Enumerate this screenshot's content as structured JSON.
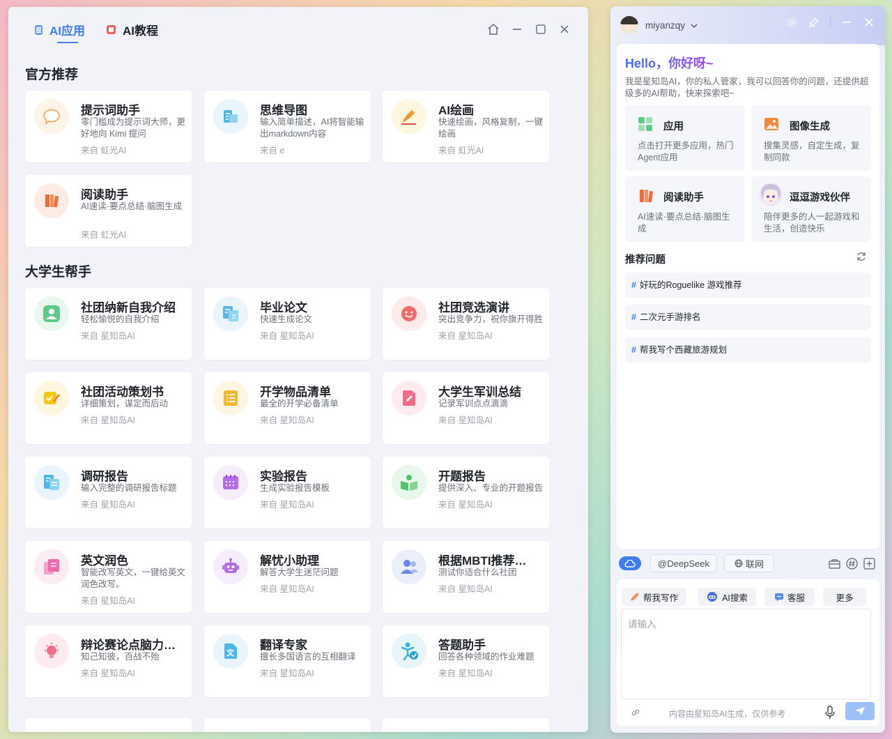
{
  "tabs": [
    {
      "label": "AI应用",
      "active": true
    },
    {
      "label": "AI教程",
      "active": false
    }
  ],
  "sections": [
    {
      "title": "官方推荐",
      "cards": [
        {
          "title": "提示词助手",
          "desc": "零门槛成为提示词大师，更好地向 Kimi 提问",
          "source": "来自 虹光AI",
          "icon": "chat-bubble-icon",
          "color": "#f7a24a"
        },
        {
          "title": "思维导图",
          "desc": "输入简单描述，AI将智能输出markdown内容",
          "source": "来自 e",
          "icon": "mindmap-icon",
          "color": "#4fb7e8"
        },
        {
          "title": "AI绘画",
          "desc": "快速绘画，风格复制，一键绘画",
          "source": "来自 虹光AI",
          "icon": "paint-icon",
          "color": "#f5c518"
        },
        {
          "title": "阅读助手",
          "desc": "AI速读·要点总结·脑图生成",
          "source": "来自 虹光AI",
          "icon": "book-icon",
          "color": "#f26b3a"
        }
      ]
    },
    {
      "title": "大学生帮手",
      "cards": [
        {
          "title": "社团纳新自我介绍",
          "desc": "轻松愉悦的自我介绍",
          "source": "来自 星知岛AI",
          "icon": "person-icon",
          "color": "#5dc98a"
        },
        {
          "title": "毕业论文",
          "desc": "快速生成论文",
          "source": "来自 星知岛AI",
          "icon": "thesis-icon",
          "color": "#5cb5e4"
        },
        {
          "title": "社团竞选演讲",
          "desc": "突出竞争力，祝你旗开得胜",
          "source": "来自 星知岛AI",
          "icon": "smile-icon",
          "color": "#f26b6b"
        },
        {
          "title": "社团活动策划书",
          "desc": "详细策划，谋定而后动",
          "source": "来自 星知岛AI",
          "icon": "plan-icon",
          "color": "#f5c518"
        },
        {
          "title": "开学物品清单",
          "desc": "最全的开学必备清单",
          "source": "来自 星知岛AI",
          "icon": "list-icon",
          "color": "#f5b82e"
        },
        {
          "title": "大学生军训总结",
          "desc": "记录军训点点滴滴",
          "source": "来自 星知岛AI",
          "icon": "edit-icon",
          "color": "#f56c8b"
        },
        {
          "title": "调研报告",
          "desc": "输入完整的调研报告标题",
          "source": "来自 星知岛AI",
          "icon": "report-icon",
          "color": "#4fb7e8"
        },
        {
          "title": "实验报告",
          "desc": "生成实验报告模板",
          "source": "来自 星知岛AI",
          "icon": "calendar-icon",
          "color": "#b46ee8"
        },
        {
          "title": "开题报告",
          "desc": "提供深入、专业的开题报告",
          "source": "来自 星知岛AI",
          "icon": "open-book-icon",
          "color": "#4fc46b"
        },
        {
          "title": "英文润色",
          "desc": "智能改写英文，一键给英文润色改写。",
          "source": "来自 星知岛AI",
          "icon": "copy-icon",
          "color": "#f06aa8"
        },
        {
          "title": "解忧小助理",
          "desc": "解答大学生迷茫问题",
          "source": "来自 星知岛AI",
          "icon": "robot-icon",
          "color": "#b46ee8"
        },
        {
          "title": "根据MBTI推荐…",
          "desc": "测试你适合什么社团",
          "source": "来自 星知岛AI",
          "icon": "users-icon",
          "color": "#6a86e8"
        },
        {
          "title": "辩论赛论点脑力…",
          "desc": "知己知彼，百战不殆",
          "source": "来自 星知岛AI",
          "icon": "bulb-icon",
          "color": "#f56c8b"
        },
        {
          "title": "翻译专家",
          "desc": "擅长多国语言的互相翻译",
          "source": "来自 星知岛AI",
          "icon": "translate-icon",
          "color": "#4fb7e8"
        },
        {
          "title": "答题助手",
          "desc": "回答各种领域的作业难题",
          "source": "来自 星知岛AI",
          "icon": "check-person-icon",
          "color": "#3db2d8"
        }
      ]
    }
  ],
  "assistant": {
    "username": "miyanzqy",
    "hello": "Hello，你好呀~",
    "intro": "我是星知岛AI，你的私人管家，我可以回答你的问题，还提供超级多的AI帮助，快来探索吧~",
    "quick": [
      {
        "title": "应用",
        "desc": "点击打开更多应用，热门Agent应用",
        "icon": "apps-icon",
        "color": "#5dc98a"
      },
      {
        "title": "图像生成",
        "desc": "搜集灵感，自定生成，复制同款",
        "icon": "image-icon",
        "color": "#f28a3a"
      },
      {
        "title": "阅读助手",
        "desc": "AI速读·要点总结·脑图生成",
        "icon": "book-icon",
        "color": "#f26b3a"
      },
      {
        "title": "逗逗游戏伙伴",
        "desc": "陪伴更多的人一起游戏和生活，创造快乐",
        "icon": "anime-avatar-icon",
        "color": "#c9b8e8"
      }
    ],
    "rec_title": "推荐问题",
    "rec_items": [
      "好玩的Roguelike 游戏推荐",
      "二次元手游排名",
      "帮我写个西藏旅游规划"
    ],
    "model": "@DeepSeek",
    "web": "联网",
    "quick_actions": [
      "帮我写作",
      "AI搜索",
      "客服",
      "更多"
    ],
    "input_placeholder": "请输入",
    "disclaimer": "内容由星知岛AI生成，仅供参考"
  }
}
